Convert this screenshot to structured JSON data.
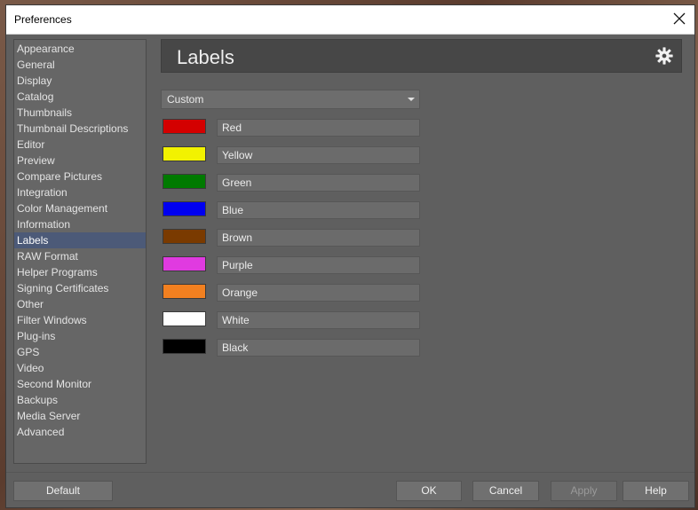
{
  "window": {
    "title": "Preferences"
  },
  "sidebar": {
    "items": [
      {
        "label": "Appearance"
      },
      {
        "label": "General"
      },
      {
        "label": "Display"
      },
      {
        "label": "Catalog"
      },
      {
        "label": "Thumbnails"
      },
      {
        "label": "Thumbnail Descriptions"
      },
      {
        "label": "Editor"
      },
      {
        "label": "Preview"
      },
      {
        "label": "Compare Pictures"
      },
      {
        "label": "Integration"
      },
      {
        "label": "Color Management"
      },
      {
        "label": "Information"
      },
      {
        "label": "Labels"
      },
      {
        "label": "RAW Format"
      },
      {
        "label": "Helper Programs"
      },
      {
        "label": "Signing Certificates"
      },
      {
        "label": "Other"
      },
      {
        "label": "Filter Windows"
      },
      {
        "label": "Plug-ins"
      },
      {
        "label": "GPS"
      },
      {
        "label": "Video"
      },
      {
        "label": "Second Monitor"
      },
      {
        "label": "Backups"
      },
      {
        "label": "Media Server"
      },
      {
        "label": "Advanced"
      }
    ],
    "selected": "Labels"
  },
  "main": {
    "title": "Labels",
    "settings_icon": "gear-icon",
    "preset": {
      "value": "Custom"
    },
    "labels": [
      {
        "name": "Red",
        "color": "#d40000"
      },
      {
        "name": "Yellow",
        "color": "#f2f200"
      },
      {
        "name": "Green",
        "color": "#007a00"
      },
      {
        "name": "Blue",
        "color": "#0000f0"
      },
      {
        "name": "Brown",
        "color": "#7a3a00"
      },
      {
        "name": "Purple",
        "color": "#e03ae0"
      },
      {
        "name": "Orange",
        "color": "#f28020"
      },
      {
        "name": "White",
        "color": "#ffffff"
      },
      {
        "name": "Black",
        "color": "#000000"
      }
    ]
  },
  "footer": {
    "default_label": "Default",
    "ok_label": "OK",
    "cancel_label": "Cancel",
    "apply_label": "Apply",
    "help_label": "Help"
  }
}
